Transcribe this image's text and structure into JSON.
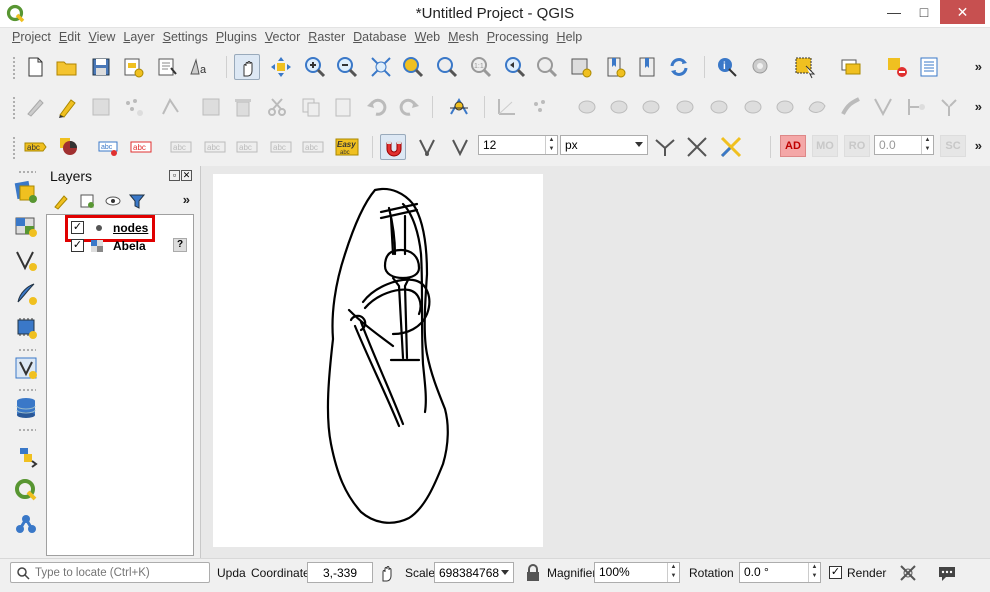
{
  "window": {
    "title": "*Untitled Project - QGIS",
    "controls": [
      "—",
      "□",
      "✕"
    ]
  },
  "menu": [
    "Project",
    "Edit",
    "View",
    "Layer",
    "Settings",
    "Plugins",
    "Vector",
    "Raster",
    "Database",
    "Web",
    "Mesh",
    "Processing",
    "Help"
  ],
  "toolbar3": {
    "snap_tolerance": "12",
    "snap_unit": "px",
    "label_ad": "AD",
    "label_mo": "MO",
    "label_ro": "RO",
    "rotation_value": "0.0",
    "label_sc": "SC",
    "label_abc": "abc",
    "label_easy": "Easy"
  },
  "layers_panel": {
    "title": "Layers",
    "overflow": "»",
    "layers": [
      {
        "name": "nodes",
        "checked": "✓"
      },
      {
        "name": "Abela",
        "checked": "✓",
        "badge": "?"
      }
    ]
  },
  "overflow": "»",
  "statusbar": {
    "locate_placeholder": "Type to locate (Ctrl+K)",
    "upda": "Upda",
    "coordinate_label": "Coordinate",
    "coordinate_value": "3,-339",
    "scale_label": "Scale",
    "scale_value": "698384768",
    "magnifier_label": "Magnifier",
    "magnifier_value": "100%",
    "rotation_label": "Rotation",
    "rotation_value": "0.0 °",
    "render_label": "Render",
    "render_checked": "✓"
  },
  "colors": {
    "accent_red": "#e00000",
    "qgis_green": "#589632",
    "qgis_yellow": "#f0c020"
  }
}
